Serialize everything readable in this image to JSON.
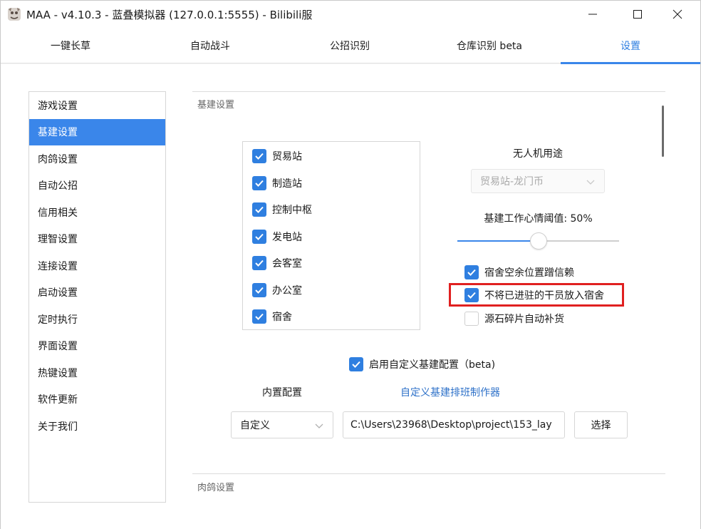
{
  "window": {
    "title": "MAA - v4.10.3 - 蓝叠模拟器 (127.0.0.1:5555) - Bilibili服",
    "icons": {
      "app": "maa-app-icon",
      "minimize": "minimize-icon",
      "maximize": "maximize-icon",
      "close": "close-icon"
    }
  },
  "tabs": [
    {
      "label": "一键长草"
    },
    {
      "label": "自动战斗"
    },
    {
      "label": "公招识别"
    },
    {
      "label": "仓库识别 beta"
    },
    {
      "label": "设置",
      "active": true
    }
  ],
  "sidebar": {
    "items": [
      {
        "label": "游戏设置"
      },
      {
        "label": "基建设置",
        "active": true
      },
      {
        "label": "肉鸽设置"
      },
      {
        "label": "自动公招"
      },
      {
        "label": "信用相关"
      },
      {
        "label": "理智设置"
      },
      {
        "label": "连接设置"
      },
      {
        "label": "启动设置"
      },
      {
        "label": "定时执行"
      },
      {
        "label": "界面设置"
      },
      {
        "label": "热键设置"
      },
      {
        "label": "软件更新"
      },
      {
        "label": "关于我们"
      }
    ]
  },
  "infrastructure": {
    "section_title": "基建设置",
    "facilities": [
      {
        "label": "贸易站",
        "checked": true
      },
      {
        "label": "制造站",
        "checked": true
      },
      {
        "label": "控制中枢",
        "checked": true
      },
      {
        "label": "发电站",
        "checked": true
      },
      {
        "label": "会客室",
        "checked": true
      },
      {
        "label": "办公室",
        "checked": true
      },
      {
        "label": "宿舍",
        "checked": true
      }
    ],
    "drone_label": "无人机用途",
    "drone_value": "贸易站-龙门币",
    "mood_label": "基建工作心情阈值: 50%",
    "mood_threshold": 0.5,
    "options": [
      {
        "label": "宿舍空余位置蹭信赖",
        "checked": true
      },
      {
        "label": "不将已进驻的干员放入宿舍",
        "checked": true
      },
      {
        "label": "源石碎片自动补货",
        "checked": false
      }
    ],
    "custom_label": "启用自定义基建配置（beta)",
    "custom_checked": true,
    "builtin_label": "内置配置",
    "editor_link": "自定义基建排班制作器",
    "builtin_value": "自定义",
    "path_value": "C:\\Users\\23968\\Desktop\\project\\153_lay",
    "choose_label": "选择"
  },
  "next_section": {
    "title": "肉鸽设置"
  },
  "colors": {
    "accent": "#3a86ea",
    "highlight": "#e02020",
    "link": "#2f72c9"
  }
}
